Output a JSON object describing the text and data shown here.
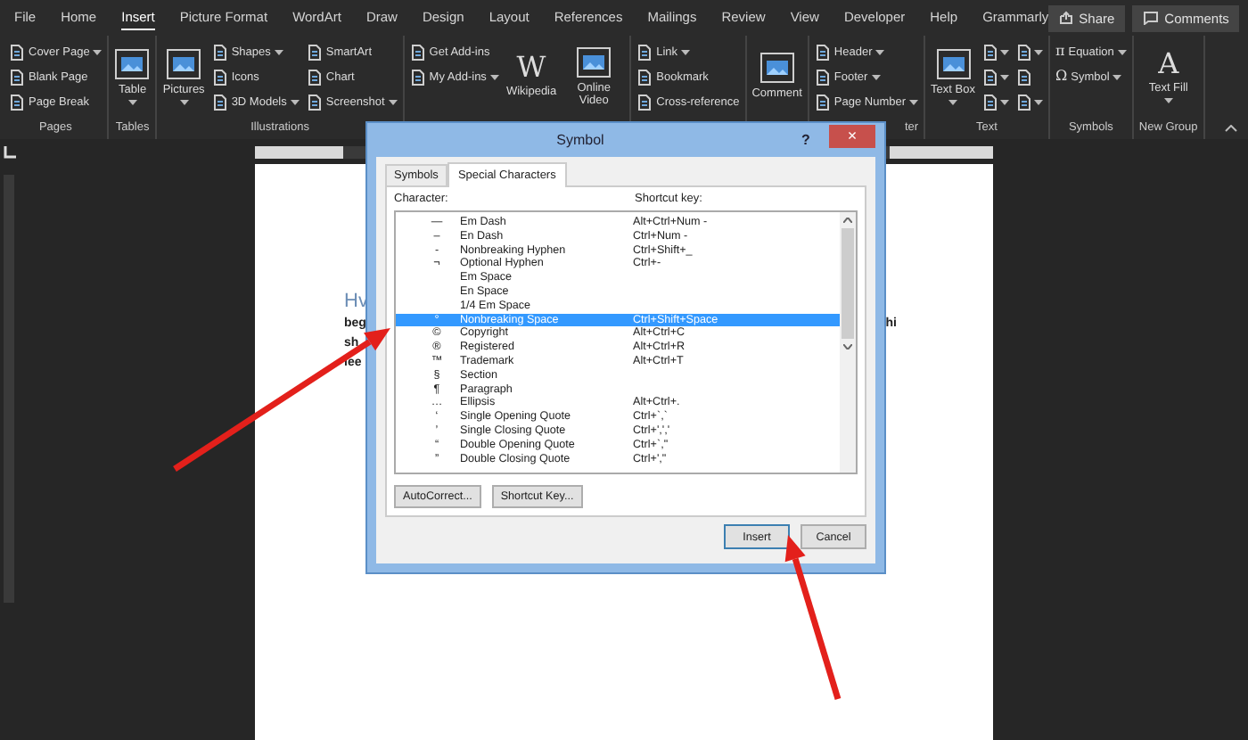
{
  "tabs": [
    {
      "label": "File",
      "selected": false
    },
    {
      "label": "Home",
      "selected": false
    },
    {
      "label": "Insert",
      "selected": true
    },
    {
      "label": "Picture Format",
      "selected": false
    },
    {
      "label": "WordArt",
      "selected": false
    },
    {
      "label": "Draw",
      "selected": false
    },
    {
      "label": "Design",
      "selected": false
    },
    {
      "label": "Layout",
      "selected": false
    },
    {
      "label": "References",
      "selected": false
    },
    {
      "label": "Mailings",
      "selected": false
    },
    {
      "label": "Review",
      "selected": false
    },
    {
      "label": "View",
      "selected": false
    },
    {
      "label": "Developer",
      "selected": false
    },
    {
      "label": "Help",
      "selected": false
    },
    {
      "label": "Grammarly",
      "selected": false
    }
  ],
  "share_button": "Share",
  "comments_button": "Comments",
  "ribbon": [
    {
      "label": "Pages",
      "label_cut": false,
      "items": [
        {
          "kind": "small",
          "label": "Cover Page",
          "dropdown": true
        },
        {
          "kind": "small",
          "label": "Blank Page",
          "dropdown": false
        },
        {
          "kind": "small",
          "label": "Page Break",
          "dropdown": false
        }
      ]
    },
    {
      "label": "Tables",
      "label_cut": false,
      "items": [
        {
          "kind": "large",
          "label": "Table",
          "dropdown": true
        }
      ]
    },
    {
      "label": "Illustrations",
      "label_cut": false,
      "items": [
        {
          "kind": "large",
          "label": "Pictures",
          "dropdown": true
        },
        {
          "kind": "small",
          "label": "Shapes",
          "dropdown": true
        },
        {
          "kind": "small",
          "label": "Icons",
          "dropdown": false
        },
        {
          "kind": "small",
          "label": "3D Models",
          "dropdown": true
        },
        {
          "kind": "small",
          "label": "SmartArt",
          "dropdown": false
        },
        {
          "kind": "small",
          "label": "Chart",
          "dropdown": false
        },
        {
          "kind": "small",
          "label": "Screenshot",
          "dropdown": true
        }
      ]
    },
    {
      "items": [
        {
          "kind": "small",
          "label": "Get Add-ins",
          "dropdown": false
        },
        {
          "kind": "small",
          "label": "My Add-ins",
          "dropdown": true
        },
        {
          "kind": "large",
          "label": "Wikipedia",
          "glyph": "W",
          "dropdown": false
        },
        {
          "kind": "large",
          "label": "Online Video",
          "dropdown": false
        }
      ]
    },
    {
      "items": [
        {
          "kind": "small",
          "label": "Link",
          "dropdown": true
        },
        {
          "kind": "small",
          "label": "Bookmark",
          "dropdown": false
        },
        {
          "kind": "small",
          "label": "Cross-reference",
          "dropdown": false
        }
      ]
    },
    {
      "items": [
        {
          "kind": "large",
          "label": "Comment",
          "dropdown": false
        }
      ]
    },
    {
      "label": "ter",
      "label_cut": true,
      "items": [
        {
          "kind": "small",
          "label": "Header",
          "dropdown": true
        },
        {
          "kind": "small",
          "label": "Footer",
          "dropdown": true
        },
        {
          "kind": "small",
          "label": "Page Number",
          "dropdown": true
        }
      ]
    },
    {
      "label": "Text",
      "label_cut": false,
      "items": [
        {
          "kind": "large",
          "label": "Text Box",
          "dropdown": true
        },
        {
          "kind": "icon",
          "dropdown": true
        },
        {
          "kind": "icon",
          "dropdown": true
        },
        {
          "kind": "icon",
          "dropdown": true
        },
        {
          "kind": "icon",
          "dropdown": true
        },
        {
          "kind": "icon",
          "dropdown": false
        },
        {
          "kind": "icon",
          "dropdown": true
        }
      ]
    },
    {
      "label": "Symbols",
      "label_cut": false,
      "items": [
        {
          "kind": "small",
          "label": "Equation",
          "glyph": "π",
          "dropdown": true
        },
        {
          "kind": "small",
          "label": "Symbol",
          "glyph": "Ω",
          "dropdown": true
        }
      ]
    },
    {
      "label": "New Group",
      "label_cut": false,
      "items": [
        {
          "kind": "large",
          "label": "Text Fill",
          "glyph": "A",
          "dropdown": true
        }
      ]
    }
  ],
  "document": {
    "heading": "Hv",
    "lines": [
      {
        "left": "beg",
        "right": "hi"
      },
      {
        "left": "sh"
      },
      {
        "left": "lee"
      }
    ]
  },
  "dialog": {
    "title": "Symbol",
    "help": "?",
    "close": "×",
    "tabs": [
      {
        "label": "Symbols",
        "selected": false
      },
      {
        "label": "Special Characters",
        "selected": true
      }
    ],
    "columns": [
      "Character:",
      "Shortcut key:"
    ],
    "rows": [
      {
        "character": "—",
        "name": "Em Dash",
        "shortcut": "Alt+Ctrl+Num -",
        "selected": false
      },
      {
        "character": "–",
        "name": "En Dash",
        "shortcut": "Ctrl+Num -",
        "selected": false
      },
      {
        "character": "-",
        "name": "Nonbreaking Hyphen",
        "shortcut": "Ctrl+Shift+_",
        "selected": false
      },
      {
        "character": "¬",
        "name": "Optional Hyphen",
        "shortcut": "Ctrl+-",
        "selected": false
      },
      {
        "name": "Em Space",
        "selected": false
      },
      {
        "name": "En Space",
        "selected": false
      },
      {
        "name": "1/4 Em Space",
        "selected": false
      },
      {
        "character": "°",
        "name": "Nonbreaking Space",
        "shortcut": "Ctrl+Shift+Space",
        "selected": true
      },
      {
        "character": "©",
        "name": "Copyright",
        "shortcut": "Alt+Ctrl+C",
        "selected": false
      },
      {
        "character": "®",
        "name": "Registered",
        "shortcut": "Alt+Ctrl+R",
        "selected": false
      },
      {
        "character": "™",
        "name": "Trademark",
        "shortcut": "Alt+Ctrl+T",
        "selected": false
      },
      {
        "character": "§",
        "name": "Section",
        "selected": false
      },
      {
        "character": "¶",
        "name": "Paragraph",
        "selected": false
      },
      {
        "character": "…",
        "name": "Ellipsis",
        "shortcut": "Alt+Ctrl+.",
        "selected": false
      },
      {
        "character": "‘",
        "name": "Single Opening Quote",
        "shortcut": "Ctrl+`,`",
        "selected": false
      },
      {
        "character": "’",
        "name": "Single Closing Quote",
        "shortcut": "Ctrl+',','",
        "selected": false
      },
      {
        "character": "“",
        "name": "Double Opening Quote",
        "shortcut": "Ctrl+`,\"",
        "selected": false
      },
      {
        "character": "”",
        "name": "Double Closing Quote",
        "shortcut": "Ctrl+',\"",
        "selected": false
      }
    ],
    "option_buttons": [
      "AutoCorrect...",
      "Shortcut Key..."
    ],
    "action_buttons": [
      {
        "label": "Insert",
        "default": true
      },
      {
        "label": "Cancel",
        "default": false
      }
    ]
  }
}
